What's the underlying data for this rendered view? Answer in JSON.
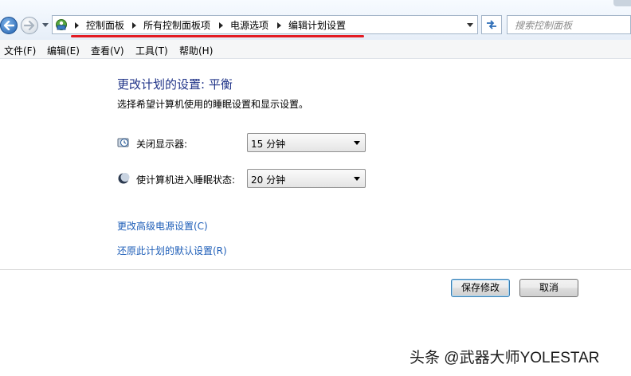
{
  "address_bar": {
    "breadcrumbs": [
      "控制面板",
      "所有控制面板项",
      "电源选项",
      "编辑计划设置"
    ],
    "search_placeholder": "搜索控制面板"
  },
  "menu": {
    "items": [
      "文件(F)",
      "编辑(E)",
      "查看(V)",
      "工具(T)",
      "帮助(H)"
    ]
  },
  "main": {
    "title": "更改计划的设置: 平衡",
    "subtitle": "选择希望计算机使用的睡眠设置和显示设置。",
    "settings": [
      {
        "label": "关闭显示器:",
        "value": "15 分钟",
        "icon": "monitor-clock-icon"
      },
      {
        "label": "使计算机进入睡眠状态:",
        "value": "20 分钟",
        "icon": "moon-icon"
      }
    ],
    "links": [
      "更改高级电源设置(C)",
      "还原此计划的默认设置(R)"
    ]
  },
  "buttons": {
    "save": "保存修改",
    "cancel": "取消"
  },
  "watermark": "头条 @武器大师YOLESTAR",
  "colors": {
    "title": "#1e3287",
    "link": "#1e5eb8",
    "annotation_line": "#e31b23"
  }
}
